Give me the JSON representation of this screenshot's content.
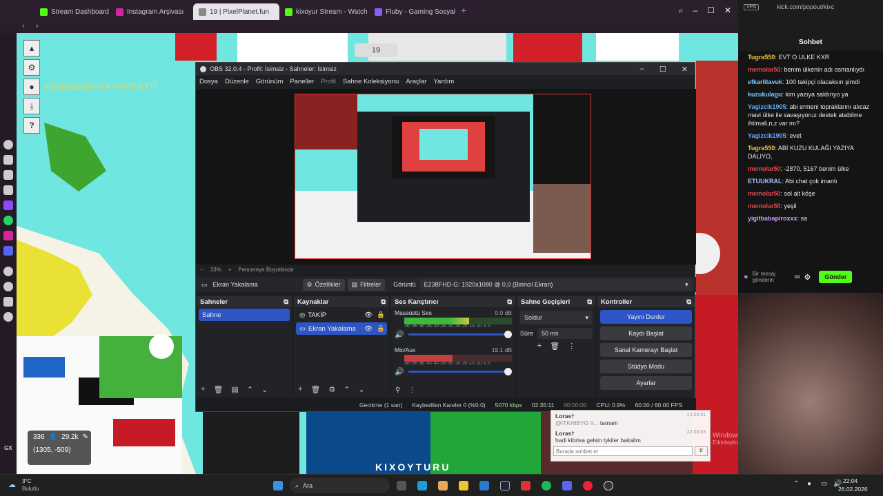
{
  "browser": {
    "tabs": [
      {
        "label": "Stream Dashboard",
        "color": "#53fc18"
      },
      {
        "label": "Instagram Arşivası",
        "color": "#d6249f"
      },
      {
        "label": "19 | PixelPlanet.fun",
        "color": "#888888",
        "active": true
      },
      {
        "label": "kixoyur Stream - Watch Li",
        "color": "#53fc18"
      },
      {
        "label": "Fluby - Gaming Sosyal Me",
        "color": "#8a5cf6"
      }
    ],
    "popout_url": "kick.com/popout/kixc",
    "vpn_badge": "VPN"
  },
  "map": {
    "overlay_text": "yigitbabapiroxxx TAKİP ETTİ",
    "center_number": "19",
    "stats": {
      "count": "336",
      "users": "29.2k",
      "coords": "(1305, -509)"
    },
    "left_label": "GX",
    "bottom_label": "KIXOYTURU"
  },
  "obs": {
    "title": "OBS 32.0.4 - Profil: İsimsiz - Sahneler: İsimsiz",
    "menu": [
      "Dosya",
      "Düzenle",
      "Görünüm",
      "Paneller",
      "Profil",
      "Sahne Koleksiyonu",
      "Araçlar",
      "Yardım"
    ],
    "zoom": "33%",
    "zoom_label": "Pencereye Boyutlandır",
    "source_name": "Ekran Yakalama",
    "properties_btn": "Özellikler",
    "filters_btn": "Filtreler",
    "display_label": "Görüntü",
    "display_value": "E238FHD-G: 1920x1080 @ 0,0 (Birincil Ekran)",
    "docks": {
      "scenes": {
        "title": "Sahneler",
        "items": [
          "Sahne"
        ]
      },
      "sources": {
        "title": "Kaynaklar",
        "items": [
          "TAKİP",
          "Ekran Yakalama"
        ]
      },
      "mixer": {
        "title": "Ses Karıştırıcı",
        "channels": [
          {
            "name": "Masaüstü Ses",
            "db": "0.0 dB",
            "level": 0.6
          },
          {
            "name": "Mic/Aux",
            "db": "19.1 dB",
            "level": 0.45
          }
        ],
        "scale": "-60 -55 -50 -45 -40 -35 -30 -25 -20 -15 -10 -5 0"
      },
      "transitions": {
        "title": "Sahne Geçişleri",
        "type": "Soldur",
        "duration_label": "Süre",
        "duration": "50 ms"
      },
      "controls": {
        "title": "Kontroller",
        "buttons": [
          "Yayını Durdur",
          "Kaydı Başlat",
          "Sanal Kamerayı Başlat",
          "Stüdyo Modu",
          "Ayarlar"
        ]
      }
    },
    "status": {
      "delay": "Gecikme (1 san)",
      "dropped": "Kaybedilen Kareler 0 (%0.0)",
      "bitrate": "5070 kbps",
      "live_time": "02:35:11",
      "rec_time": "00:00:00",
      "cpu": "CPU: 0.9%",
      "fps": "60.00 / 60.00 FPS"
    }
  },
  "chat": {
    "title": "Sohbet",
    "messages": [
      {
        "user": "Tugra550",
        "color": "#f5c542",
        "text": "EVT O ULKE KXR"
      },
      {
        "user": "memolar50",
        "color": "#e0474c",
        "text": "benim ülkenin adı osmanlıydı"
      },
      {
        "user": "efkarlitavuk",
        "color": "#7ec8ff",
        "text": "100 takipçi olacaksın şimdi"
      },
      {
        "user": "kuzukulagu",
        "color": "#7ec8ff",
        "text": "kim yazıya saldırıyo ya"
      },
      {
        "user": "Yagizcik1905",
        "color": "#5fa8ff",
        "text": "abi ermeni topraklarını alıcaz mavi ülke ile savaşıyoruz destek atabilme ihtimali,n,z var mı?"
      },
      {
        "user": "Yagizcik1905",
        "color": "#5fa8ff",
        "text": "evet"
      },
      {
        "user": "Tugra550",
        "color": "#f5c542",
        "text": "ABİ KUZU KULAĞI YAZIYA DALIYO,"
      },
      {
        "user": "memolar50",
        "color": "#e0474c",
        "text": "-2870, 5167 benim ülke"
      },
      {
        "user": "ETUUKRAL",
        "color": "#a7c4ff",
        "text": "Abi chat çok imanlı"
      },
      {
        "user": "memolar50",
        "color": "#e0474c",
        "text": "sol alt köşe"
      },
      {
        "user": "memolar50",
        "color": "#e0474c",
        "text": "yeşil"
      },
      {
        "user": "yigitbabapiroxxx",
        "color": "#c79bff",
        "text": "sa"
      }
    ],
    "input_placeholder": "Bir mesaj gönderin",
    "send_label": "Gönder"
  },
  "mini_chat": {
    "messages": [
      {
        "user": "Loras†",
        "time": "22:03:41",
        "text": "tamam",
        "mention": "@ITKHIBYG II..."
      },
      {
        "user": "Loras†",
        "time": "22:03:53",
        "text": "hadi kibrisa gelsin tykiler bakalim"
      }
    ],
    "input_placeholder": "Burada sohbet et",
    "button": "tr"
  },
  "windows": {
    "activation_line1": "Windows'u Etkinleştir",
    "activation_line2": "Etkinleştirmek için Ayarlar'a gidin.",
    "weather_temp": "3°C",
    "weather_desc": "Bulutlu",
    "search_label": "Ara",
    "time": "22:04",
    "date": "26.02.2026"
  }
}
